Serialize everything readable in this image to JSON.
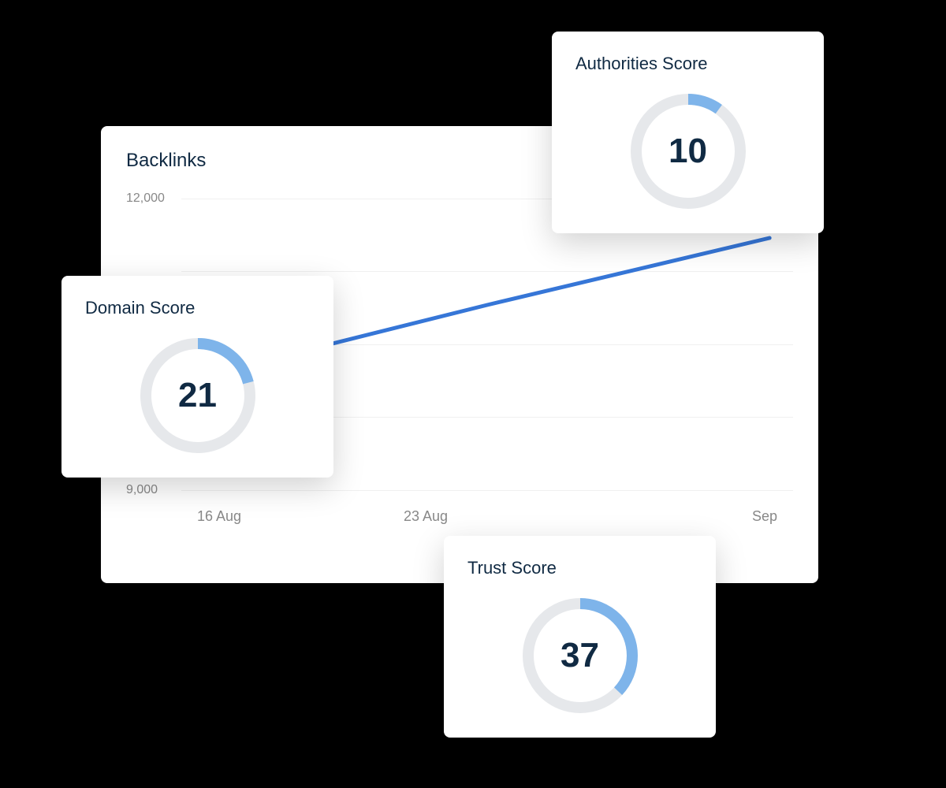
{
  "backlinks": {
    "title": "Backlinks",
    "y_ticks": [
      "12,000",
      "9,000"
    ],
    "x_ticks": [
      "16 Aug",
      "23 Aug",
      "Sep"
    ]
  },
  "scores": {
    "domain": {
      "title": "Domain Score",
      "value": 21
    },
    "authorities": {
      "title": "Authorities Score",
      "value": 10
    },
    "trust": {
      "title": "Trust Score",
      "value": 37
    }
  },
  "chart_data": [
    {
      "type": "line",
      "title": "Backlinks",
      "xlabel": "",
      "ylabel": "",
      "ylim": [
        9000,
        12000
      ],
      "x": [
        "16 Aug",
        "23 Aug",
        "Sep"
      ],
      "series": [
        {
          "name": "Backlinks",
          "values": [
            10200,
            10900,
            11600
          ]
        }
      ]
    },
    {
      "type": "gauge",
      "title": "Domain Score",
      "value": 21,
      "max": 100
    },
    {
      "type": "gauge",
      "title": "Authorities Score",
      "value": 10,
      "max": 100
    },
    {
      "type": "gauge",
      "title": "Trust Score",
      "value": 37,
      "max": 100
    }
  ]
}
